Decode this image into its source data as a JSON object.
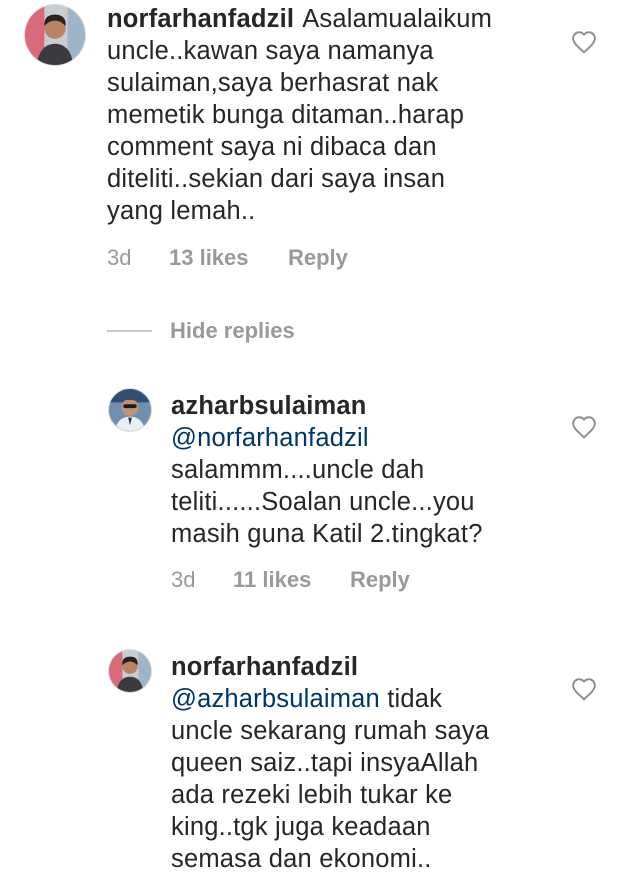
{
  "comments": [
    {
      "username": "norfarhanfadzil",
      "mention": "",
      "lines": [
        "Asalamualaikum",
        "uncle..kawan saya namanya",
        "sulaiman,saya berhasrat nak",
        "memetik bunga ditaman..harap",
        "comment saya ni dibaca dan",
        "diteliti..sekian dari saya insan",
        "yang lemah.."
      ],
      "time": "3d",
      "likes": "13 likes",
      "reply": "Reply",
      "avatar": "user-photo"
    },
    {
      "username": "azharbsulaiman",
      "mention": "@norfarhanfadzil",
      "lines": [
        "salammm....uncle dah",
        "teliti......Soalan uncle...you",
        "masih guna Katil 2.tingkat?"
      ],
      "time": "3d",
      "likes": "11 likes",
      "reply": "Reply",
      "avatar": "user-photo"
    },
    {
      "username": "norfarhanfadzil",
      "mention": "@azharbsulaiman",
      "first_line_rest": "tidak",
      "lines": [
        "uncle sekarang rumah saya",
        "queen saiz..tapi insyaAllah",
        "ada rezeki lebih tukar ke",
        "king..tgk juga keadaan",
        "semasa dan ekonomi.."
      ],
      "avatar": "user-photo"
    }
  ],
  "hide_replies": "Hide replies",
  "colors": {
    "text": "#262626",
    "muted": "#999999",
    "mention": "#003569",
    "divider": "#c7c7c7"
  },
  "icons": {
    "like": "heart-outline-icon"
  }
}
